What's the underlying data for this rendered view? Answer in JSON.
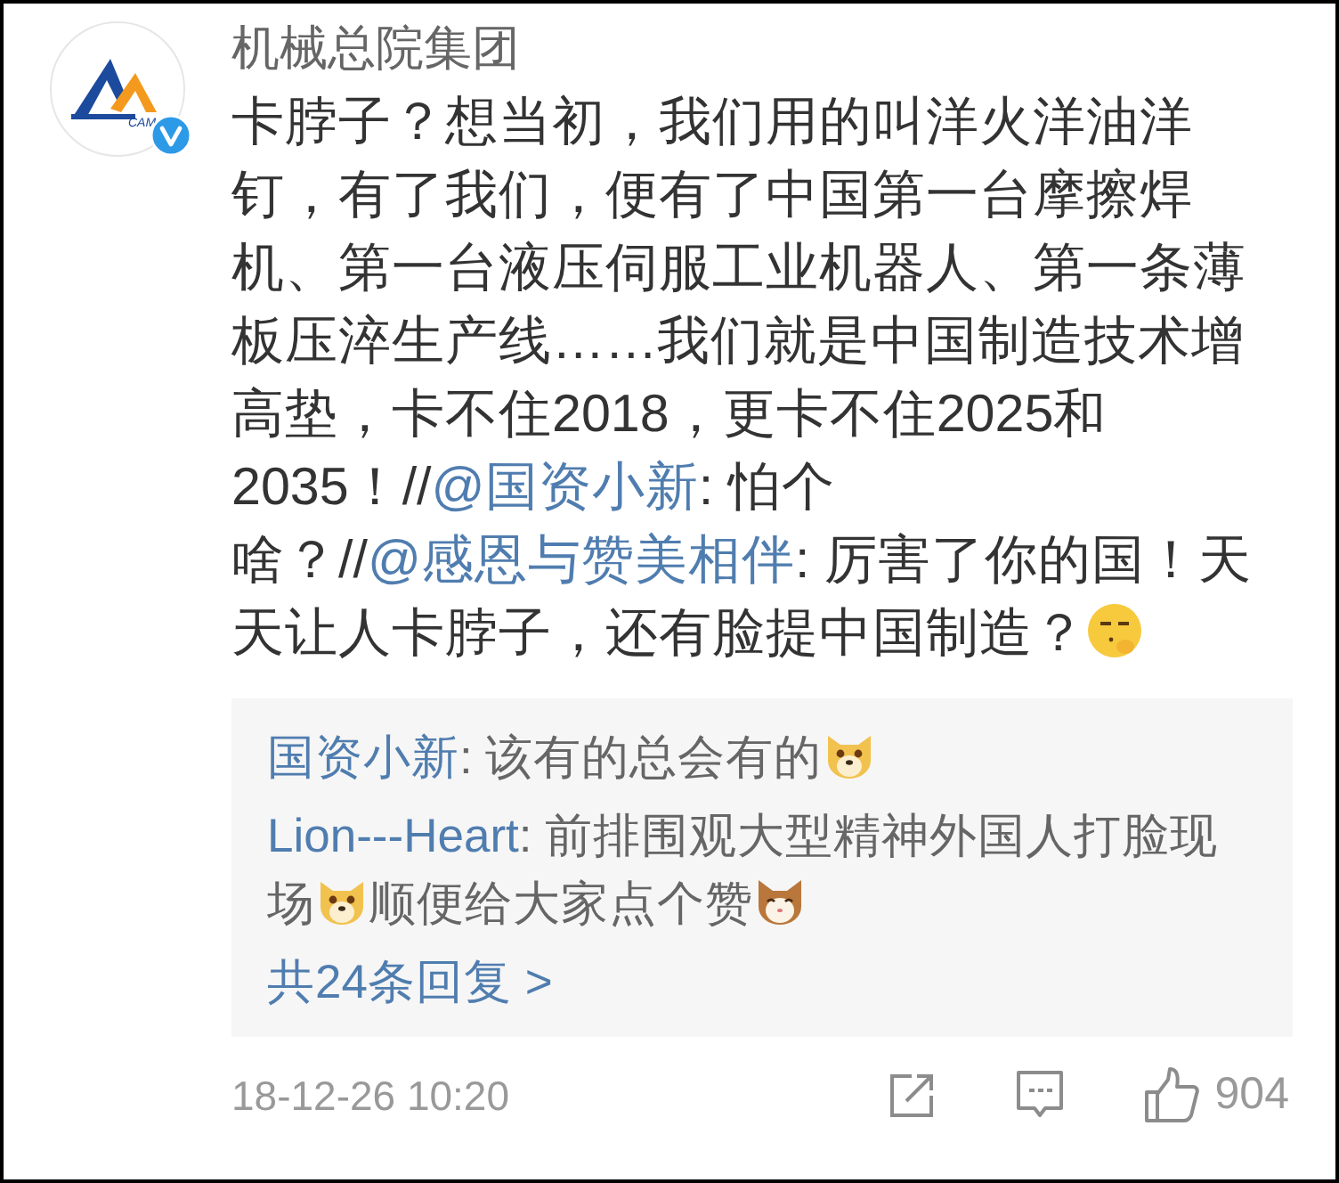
{
  "avatar": {
    "logo_text": "CAM",
    "verified": true
  },
  "author": "机械总院集团",
  "body": [
    {
      "kind": "text",
      "text": "卡脖子？想当初，我们用的叫洋火洋油洋钉，有了我们，便有了中国第一台摩擦焊机、第一台液压伺服工业机器人、第一条薄板压淬生产线……我们就是中国制造技术增高垫，卡不住2018，更卡不住2025和2035！//"
    },
    {
      "kind": "mention",
      "text": "@国资小新"
    },
    {
      "kind": "text",
      "text": ": 怕个啥？//"
    },
    {
      "kind": "mention",
      "text": "@感恩与赞美相伴"
    },
    {
      "kind": "text",
      "text": ": 厉害了你的国！天天让人卡脖子，还有脸提中国制造？"
    },
    {
      "kind": "shush"
    }
  ],
  "replies": [
    {
      "user": "国资小新",
      "parts": [
        {
          "kind": "text",
          "text": ": 该有的总会有的"
        },
        {
          "kind": "doge"
        }
      ]
    },
    {
      "user": "Lion---Heart",
      "parts": [
        {
          "kind": "text",
          "text": ": 前排围观大型精神外国人打脸现场"
        },
        {
          "kind": "doge"
        },
        {
          "kind": "text",
          "text": "顺便给大家点个赞"
        },
        {
          "kind": "cat"
        }
      ]
    }
  ],
  "more_replies": "共24条回复 >",
  "time": "18-12-26 10:20",
  "likes": "904"
}
